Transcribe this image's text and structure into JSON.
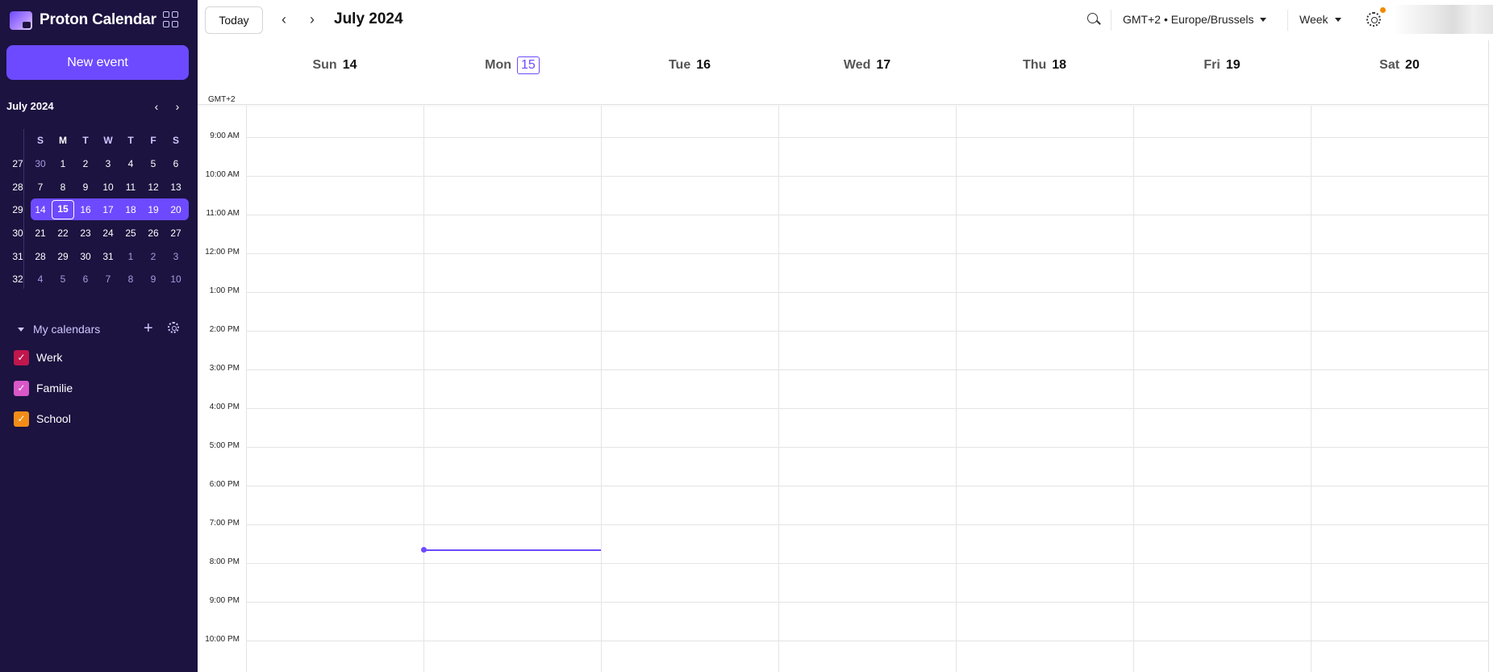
{
  "app": {
    "name": "Proton Calendar"
  },
  "sidebar": {
    "new_event_label": "New event",
    "mini_calendar": {
      "title": "July 2024",
      "weekdays": [
        "S",
        "M",
        "T",
        "W",
        "T",
        "F",
        "S"
      ],
      "weeks": [
        {
          "num": "27",
          "days": [
            "30",
            "1",
            "2",
            "3",
            "4",
            "5",
            "6"
          ]
        },
        {
          "num": "28",
          "days": [
            "7",
            "8",
            "9",
            "10",
            "11",
            "12",
            "13"
          ]
        },
        {
          "num": "29",
          "days": [
            "14",
            "15",
            "16",
            "17",
            "18",
            "19",
            "20"
          ]
        },
        {
          "num": "30",
          "days": [
            "21",
            "22",
            "23",
            "24",
            "25",
            "26",
            "27"
          ]
        },
        {
          "num": "31",
          "days": [
            "28",
            "29",
            "30",
            "31",
            "1",
            "2",
            "3"
          ]
        },
        {
          "num": "32",
          "days": [
            "4",
            "5",
            "6",
            "7",
            "8",
            "9",
            "10"
          ]
        }
      ]
    },
    "my_calendars_label": "My calendars",
    "calendars": [
      {
        "name": "Werk",
        "color": "#c0174d"
      },
      {
        "name": "Familie",
        "color": "#d957c9"
      },
      {
        "name": "School",
        "color": "#f28c18"
      }
    ]
  },
  "toolbar": {
    "today_label": "Today",
    "period_title": "July 2024",
    "timezone": "GMT+2 • Europe/Brussels",
    "view": "Week"
  },
  "week": {
    "timezone_label": "GMT+2",
    "days": [
      {
        "name": "Sun",
        "num": "14"
      },
      {
        "name": "Mon",
        "num": "15"
      },
      {
        "name": "Tue",
        "num": "16"
      },
      {
        "name": "Wed",
        "num": "17"
      },
      {
        "name": "Thu",
        "num": "18"
      },
      {
        "name": "Fri",
        "num": "19"
      },
      {
        "name": "Sat",
        "num": "20"
      }
    ],
    "hours": [
      "9:00 AM",
      "10:00 AM",
      "11:00 AM",
      "12:00 PM",
      "1:00 PM",
      "2:00 PM",
      "3:00 PM",
      "4:00 PM",
      "5:00 PM",
      "6:00 PM",
      "7:00 PM",
      "8:00 PM",
      "9:00 PM",
      "10:00 PM"
    ]
  },
  "colors": {
    "accent": "#6d4aff",
    "sidebar_bg": "#1c1340"
  }
}
